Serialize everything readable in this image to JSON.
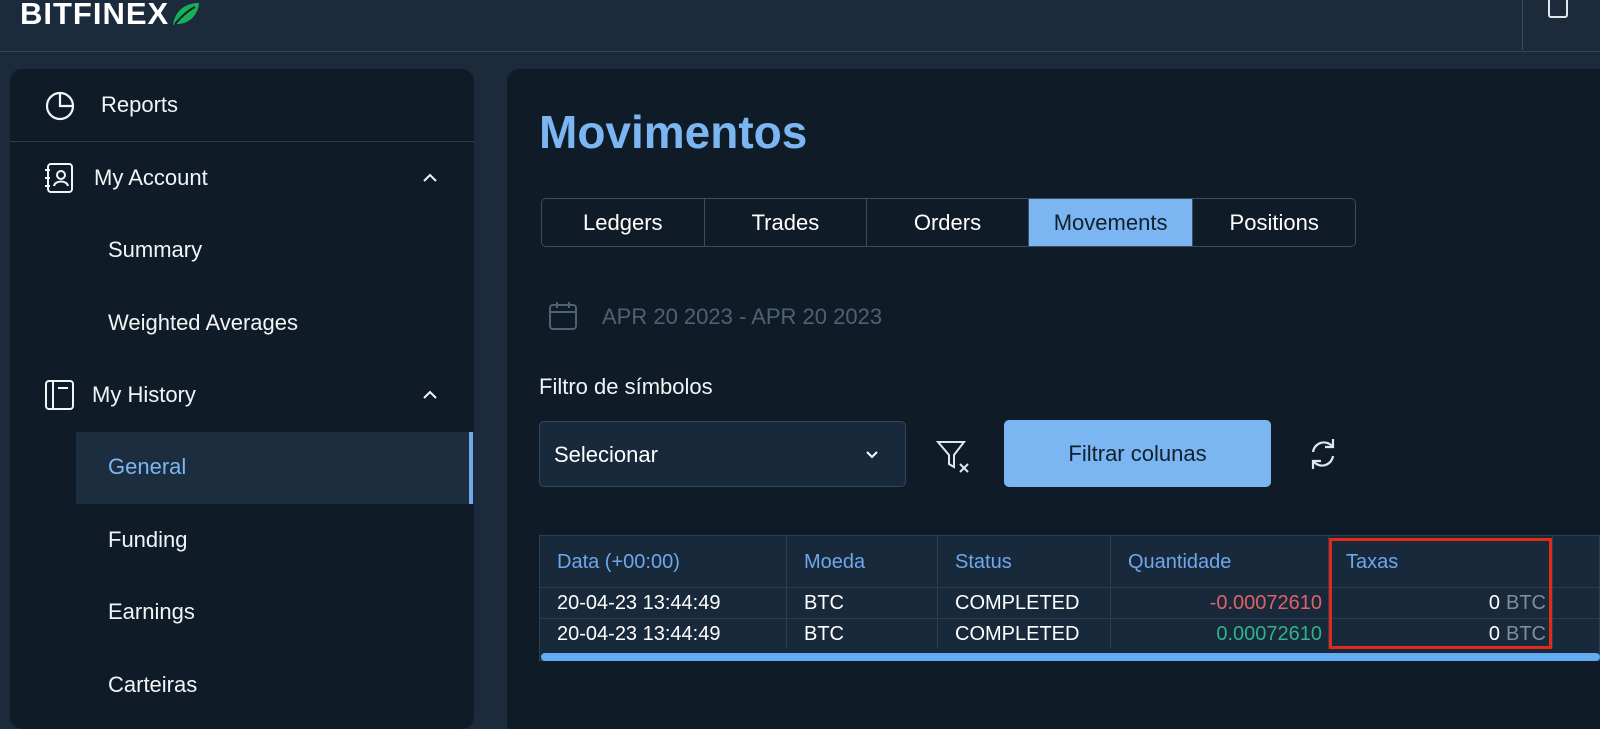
{
  "app": {
    "logo": "BITFINEX"
  },
  "sidebar": {
    "reports": "Reports",
    "my_account": "My Account",
    "summary": "Summary",
    "weighted_averages": "Weighted Averages",
    "my_history": "My History",
    "general": "General",
    "funding": "Funding",
    "earnings": "Earnings",
    "carteiras": "Carteiras"
  },
  "main": {
    "title": "Movimentos",
    "tabs": [
      {
        "label": "Ledgers",
        "active": false
      },
      {
        "label": "Trades",
        "active": false
      },
      {
        "label": "Orders",
        "active": false
      },
      {
        "label": "Movements",
        "active": true
      },
      {
        "label": "Positions",
        "active": false
      }
    ],
    "date_range": "APR 20 2023 - APR 20 2023",
    "symbol_filter_label": "Filtro de símbolos",
    "select_value": "Selecionar",
    "filter_columns_button": "Filtrar colunas"
  },
  "table": {
    "headers": [
      "Data (+00:00)",
      "Moeda",
      "Status",
      "Quantidade",
      "Taxas"
    ],
    "rows": [
      {
        "date": "20-04-23 13:44:49",
        "currency": "BTC",
        "status": "COMPLETED",
        "amount": "-0.00072610",
        "fee": "0",
        "fee_unit": "BTC"
      },
      {
        "date": "20-04-23 13:44:49",
        "currency": "BTC",
        "status": "COMPLETED",
        "amount": "0.00072610",
        "fee": "0",
        "fee_unit": "BTC"
      }
    ]
  },
  "colors": {
    "accent": "#7cb6f2",
    "negative": "#e06363",
    "positive": "#2fb38c",
    "highlight": "#e02a1a"
  }
}
